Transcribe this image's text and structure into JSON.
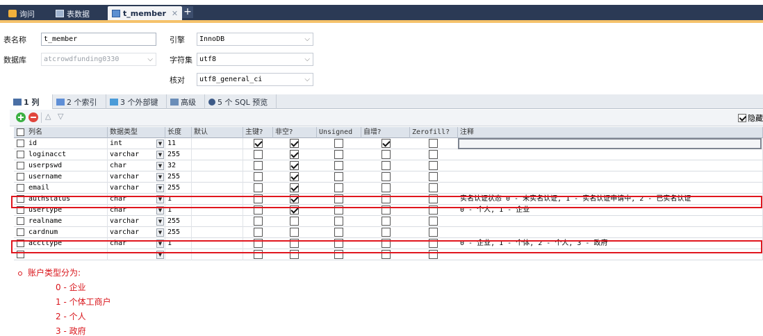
{
  "doc_tabs": [
    {
      "label": "询问",
      "icon": "query-icon",
      "active": false
    },
    {
      "label": "表数据",
      "icon": "table-data-icon",
      "active": false
    },
    {
      "label": "t_member",
      "icon": "table-design-icon",
      "active": true
    }
  ],
  "form": {
    "table_name_label": "表名称",
    "table_name_value": "t_member",
    "database_label": "数据库",
    "database_value": "atcrowdfunding0330",
    "engine_label": "引擎",
    "engine_value": "InnoDB",
    "charset_label": "字符集",
    "charset_value": "utf8",
    "collation_label": "核对",
    "collation_value": "utf8_general_ci"
  },
  "sub_tabs": [
    {
      "label": "1 列",
      "icon": "columns-icon",
      "active": true
    },
    {
      "label": "2 个索引",
      "icon": "index-icon",
      "active": false
    },
    {
      "label": "3 个外部键",
      "icon": "foreign-key-icon",
      "active": false
    },
    {
      "label": "高级",
      "icon": "advanced-icon",
      "active": false
    },
    {
      "label": "5 个 SQL 预览",
      "icon": "sql-preview-icon",
      "active": false
    }
  ],
  "toolbar": {
    "hide_label": "隐藏"
  },
  "grid": {
    "headers": [
      "列名",
      "数据类型",
      "长度",
      "默认",
      "主键?",
      "非空?",
      "Unsigned",
      "自增?",
      "Zerofill?",
      "注释"
    ],
    "rows": [
      {
        "name": "id",
        "type": "int",
        "length": "11",
        "default": "",
        "pk": true,
        "notnull": true,
        "unsigned": false,
        "autoinc": true,
        "zerofill": false,
        "comment": ""
      },
      {
        "name": "loginacct",
        "type": "varchar",
        "length": "255",
        "default": "",
        "pk": false,
        "notnull": true,
        "unsigned": false,
        "autoinc": false,
        "zerofill": false,
        "comment": ""
      },
      {
        "name": "userpswd",
        "type": "char",
        "length": "32",
        "default": "",
        "pk": false,
        "notnull": true,
        "unsigned": false,
        "autoinc": false,
        "zerofill": false,
        "comment": ""
      },
      {
        "name": "username",
        "type": "varchar",
        "length": "255",
        "default": "",
        "pk": false,
        "notnull": true,
        "unsigned": false,
        "autoinc": false,
        "zerofill": false,
        "comment": ""
      },
      {
        "name": "email",
        "type": "varchar",
        "length": "255",
        "default": "",
        "pk": false,
        "notnull": true,
        "unsigned": false,
        "autoinc": false,
        "zerofill": false,
        "comment": ""
      },
      {
        "name": "authstatus",
        "type": "char",
        "length": "1",
        "default": "",
        "pk": false,
        "notnull": true,
        "unsigned": false,
        "autoinc": false,
        "zerofill": false,
        "comment": "实名认证状态 0 - 未实名认证, 1 - 实名认证申请中, 2 - 已实名认证"
      },
      {
        "name": "usertype",
        "type": "char",
        "length": "1",
        "default": "",
        "pk": false,
        "notnull": true,
        "unsigned": false,
        "autoinc": false,
        "zerofill": false,
        "comment": " 0 - 个人, 1 - 企业"
      },
      {
        "name": "realname",
        "type": "varchar",
        "length": "255",
        "default": "",
        "pk": false,
        "notnull": false,
        "unsigned": false,
        "autoinc": false,
        "zerofill": false,
        "comment": ""
      },
      {
        "name": "cardnum",
        "type": "varchar",
        "length": "255",
        "default": "",
        "pk": false,
        "notnull": false,
        "unsigned": false,
        "autoinc": false,
        "zerofill": false,
        "comment": ""
      },
      {
        "name": "accttype",
        "type": "char",
        "length": "1",
        "default": "",
        "pk": false,
        "notnull": false,
        "unsigned": false,
        "autoinc": false,
        "zerofill": false,
        "comment": "0 - 企业, 1 - 个体, 2 - 个人, 3 - 政府"
      },
      {
        "name": "",
        "type": "",
        "length": "",
        "default": "",
        "pk": false,
        "notnull": false,
        "unsigned": false,
        "autoinc": false,
        "zerofill": false,
        "comment": ""
      }
    ]
  },
  "notes": {
    "title": "账户类型分为:",
    "items": [
      "0 - 企业",
      "1 - 个体工商户",
      "2 - 个人",
      "3 - 政府"
    ]
  },
  "colors": {
    "highlight": "#e0161e",
    "note_text": "#d9141a",
    "tab_strip": "#2b3a55",
    "accent_line": "#f5c26b"
  }
}
